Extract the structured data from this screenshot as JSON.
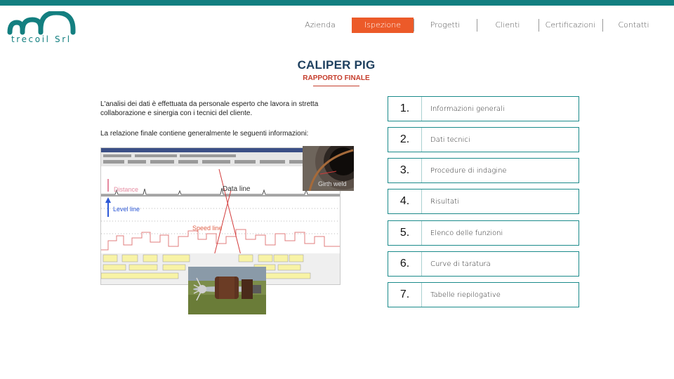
{
  "brand": {
    "logo_text": "trecoil Srl",
    "accent": "#137f80",
    "active_nav": "#ec5a29"
  },
  "nav": [
    {
      "label": "Azienda"
    },
    {
      "label": "Ispezione"
    },
    {
      "label": "Progetti"
    },
    {
      "label": "Clienti"
    },
    {
      "label": "Certificazioni"
    },
    {
      "label": "Contatti"
    }
  ],
  "header": {
    "title": "CALIPER PIG",
    "subtitle": "RAPPORTO FINALE"
  },
  "intro": {
    "p1": "L'analisi dei dati è effettuata da personale esperto che lavora in stretta collaborazione e sinergia con i tecnici del cliente.",
    "p2": "La relazione finale contiene generalmente le seguenti informazioni:"
  },
  "chart_labels": {
    "data_line": "Data line",
    "level_line": "Level line",
    "speed_line": "Speed line",
    "girth_weld": "Girth weld",
    "distance": "Distance"
  },
  "items": [
    {
      "num": "1.",
      "label": "Informazioni generali"
    },
    {
      "num": "2.",
      "label": "Dati tecnici"
    },
    {
      "num": "3.",
      "label": "Procedure di indagine"
    },
    {
      "num": "4.",
      "label": "Risultati"
    },
    {
      "num": "5.",
      "label": "Elenco delle funzioni"
    },
    {
      "num": "6.",
      "label": "Curve di taratura"
    },
    {
      "num": "7.",
      "label": "Tabelle riepilogative"
    }
  ]
}
